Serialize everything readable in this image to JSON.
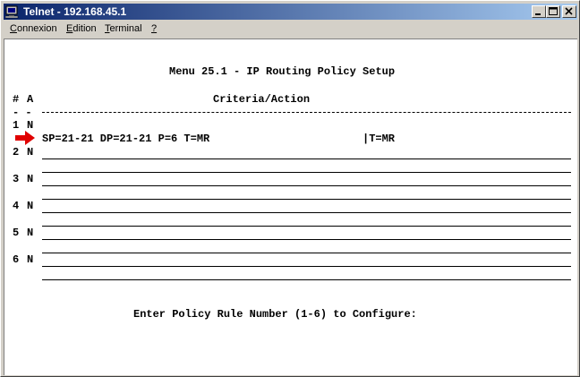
{
  "window": {
    "title": "Telnet - 192.168.45.1"
  },
  "menu": {
    "items": [
      {
        "label_prefix": "C",
        "label_rest": "onnexion"
      },
      {
        "label_prefix": "E",
        "label_rest": "dition"
      },
      {
        "label_prefix": "T",
        "label_rest": "erminal"
      },
      {
        "label_prefix": "?",
        "label_rest": ""
      }
    ]
  },
  "screen": {
    "heading": "Menu 25.1 - IP Routing Policy Setup",
    "col_num": "#",
    "col_active": "A",
    "col_criteria": "Criteria/Action",
    "header_dashes": "- -",
    "rows": [
      {
        "num": "1",
        "active": "N",
        "criteria": "SP=21-21 DP=21-21 P=6 T=MR",
        "action": "|T=MR"
      },
      {
        "num": "2",
        "active": "N",
        "criteria": "",
        "action": ""
      },
      {
        "num": "3",
        "active": "N",
        "criteria": "",
        "action": ""
      },
      {
        "num": "4",
        "active": "N",
        "criteria": "",
        "action": ""
      },
      {
        "num": "5",
        "active": "N",
        "criteria": "",
        "action": ""
      },
      {
        "num": "6",
        "active": "N",
        "criteria": "",
        "action": ""
      }
    ],
    "prompt": "Enter Policy Rule Number (1-6) to Configure:"
  },
  "colors": {
    "titlebar_start": "#0a246a",
    "titlebar_end": "#a6caf0",
    "arrow": "#e00000"
  },
  "icons": [
    "telnet-app-icon",
    "minimize-icon",
    "maximize-icon",
    "close-icon",
    "red-arrow-icon"
  ]
}
